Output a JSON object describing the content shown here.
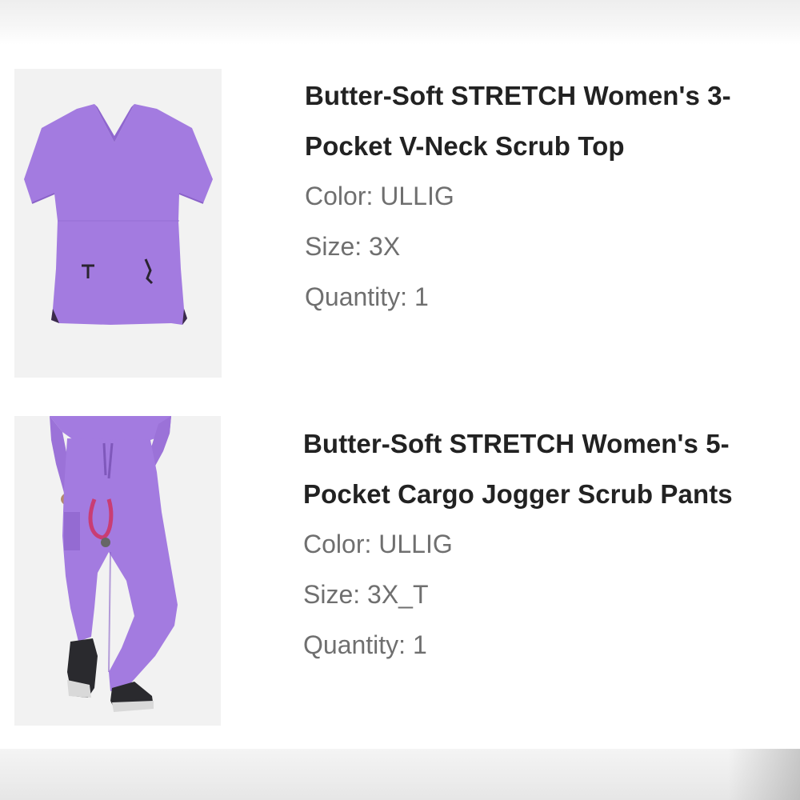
{
  "items": [
    {
      "image_desc": "purple-v-neck-scrub-top-image",
      "title_line1": "Butter-Soft STRETCH Women's 3-",
      "title_line2": "Pocket V-Neck Scrub Top",
      "color": "Color: ULLIG",
      "size": "Size: 3X",
      "quantity": "Quantity: 1"
    },
    {
      "image_desc": "purple-jogger-scrub-pants-image",
      "title_line1": "Butter-Soft STRETCH Women's 5-",
      "title_line2": "Pocket Cargo Jogger Scrub Pants",
      "color": "Color: ULLIG",
      "size": "Size: 3X_T",
      "quantity": "Quantity: 1"
    }
  ],
  "colors": {
    "product_purple": "#a37be0",
    "title_text": "#222222",
    "attr_text": "#6f6f6f",
    "thumb_bg": "#f2f2f2"
  }
}
